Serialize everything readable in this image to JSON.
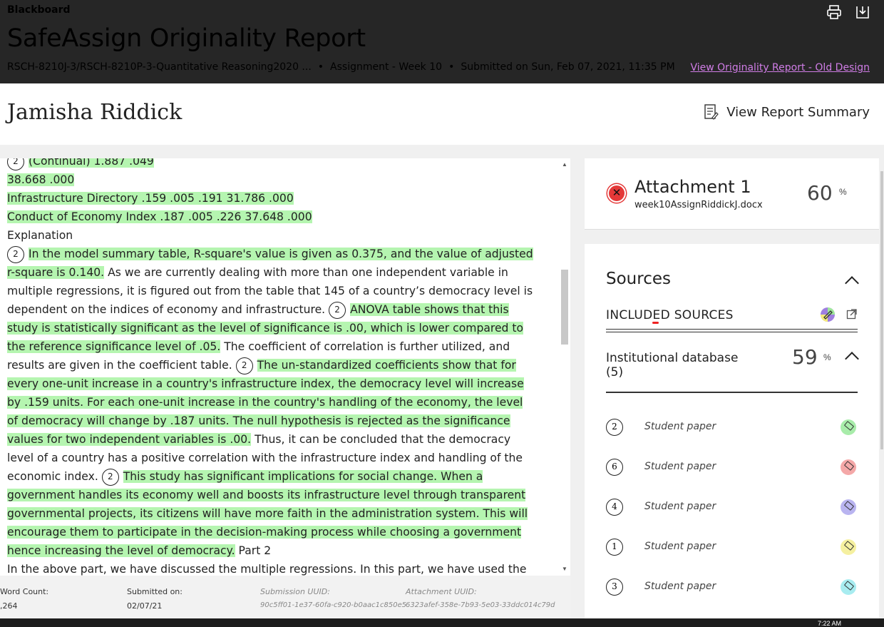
{
  "header": {
    "brand": "Blackboard",
    "title": "SafeAssign Originality Report",
    "course": "RSCH-8210J-3/RSCH-8210P-3-Quantitative Reasoning2020 ...",
    "assignment": "Assignment - Week 10",
    "submitted": "Submitted on Sun, Feb 07, 2021, 11:35 PM",
    "old_design_link": "View Originality Report - Old Design",
    "separator": "•"
  },
  "student": {
    "name": "Jamisha Riddick",
    "view_summary_label": "View Report Summary"
  },
  "document": {
    "line0_num": "2",
    "line0": "(Continual) 1.887 .049",
    "line1": "38.668 .000",
    "line2": "Infrastructure Directory .159 .005 .191 31.786 .000",
    "line3": "Conduct of Economy Index .187 .005 .226 37.648 .000",
    "line4": "Explanation",
    "p1_num": "2",
    "p1_hl1": "In the model summary table, R-square's value is given as 0.375, and the value of adjusted r-square is 0.140.",
    "p1_t1": " As we are currently dealing with more than one independent variable in multiple regressions, it is figured out from the table that 145 of a country’s democracy level is dependent on the indices of economy and infrastructure. ",
    "p1_num2": "2",
    "p1_hl2": "ANOVA table shows that this study is statistically significant as the level of significance is .00, which is lower compared to the reference significance level of .05.",
    "p1_t2": " The coefficient of correlation is further utilized, and results are given in the coefficient table. ",
    "p1_num3": "2",
    "p1_hl3": "The un-standardized coefficients show that for every one-unit increase in a country's infrastructure index, the democracy level will increase by .159 units. For each one-unit increase in the country's handling of the economy, the level of democracy will change by .187 units. The null hypothesis is rejected as the significance values for two independent variables is .00.",
    "p1_t3": " Thus, it can be concluded that the democracy level of a country has a positive correlation with the infrastructure index and handling of the economic index. ",
    "p1_num4": "2",
    "p1_hl4": "This study has significant implications for social change. When a government handles its economy well and boosts its infrastructure level through transparent governmental projects, its citizens will have more faith in the administration system. This will encourage them to participate in the decision-making process while choosing a government hence increasing the level of democracy.",
    "p1_t4": " Part 2",
    "p2": "In the above part, we have discussed the multiple regressions. In this part, we have used the dummy variable in place of an actual variable to compute the results with the same research"
  },
  "footer": {
    "word_count_label": "Word Count:",
    "word_count": ",264",
    "submitted_label": "Submitted on:",
    "submitted": "02/07/21",
    "submission_uuid_label": "Submission UUID:",
    "submission_uuid": "90c5ff01-1e37-60fa-c920-b0aac1c850e5",
    "attachment_uuid_label": "Attachment UUID:",
    "attachment_uuid": "6323afef-358e-7b93-5e03-33ddc014c79d"
  },
  "attachment": {
    "title": "Attachment 1",
    "filename": "week10AssignRiddickJ.docx",
    "percent": "60",
    "percent_sign": "%"
  },
  "sources": {
    "title": "Sources",
    "included_label": "INCLUDED SOURCES",
    "group_title": "Institutional database",
    "group_count": "(5)",
    "group_percent": "59",
    "percent_sign": "%",
    "items": [
      {
        "num": "2",
        "label": "Student paper",
        "color": "#a8ecaa"
      },
      {
        "num": "6",
        "label": "Student paper",
        "color": "#f4a8a8"
      },
      {
        "num": "4",
        "label": "Student paper",
        "color": "#b9b4f0"
      },
      {
        "num": "1",
        "label": "Student paper",
        "color": "#f5f0a0"
      },
      {
        "num": "3",
        "label": "Student paper",
        "color": "#a8ecf0"
      }
    ]
  },
  "taskbar": {
    "clock": "7:22 AM"
  }
}
